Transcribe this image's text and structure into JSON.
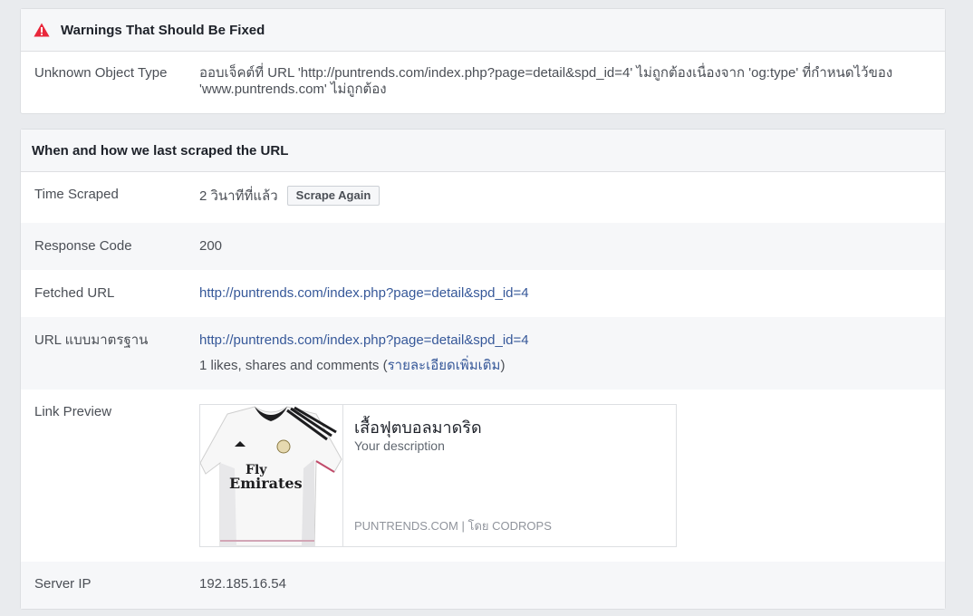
{
  "warnings": {
    "title": "Warnings That Should Be Fixed",
    "rows": [
      {
        "label": "Unknown Object Type",
        "value": "ออบเจ็คต์ที่ URL 'http://puntrends.com/index.php?page=detail&spd_id=4' ไม่ถูกต้องเนื่องจาก 'og:type' ที่กำหนดไว้ของ 'www.puntrends.com' ไม่ถูกต้อง"
      }
    ]
  },
  "scrape": {
    "title": "When and how we last scraped the URL",
    "time_scraped": {
      "label": "Time Scraped",
      "value": "2 วินาทีที่แล้ว",
      "button": "Scrape Again"
    },
    "response_code": {
      "label": "Response Code",
      "value": "200"
    },
    "fetched_url": {
      "label": "Fetched URL",
      "value": "http://puntrends.com/index.php?page=detail&spd_id=4"
    },
    "canonical_url": {
      "label": "URL แบบมาตรฐาน",
      "value": "http://puntrends.com/index.php?page=detail&spd_id=4",
      "stats": "1 likes, shares and comments (",
      "stats_link": "รายละเอียดเพิ่มเติม",
      "stats_close": ")"
    },
    "link_preview": {
      "label": "Link Preview",
      "title": "เสื้อฟุตบอลมาดริด",
      "description": "Your description",
      "domain": "PUNTRENDS.COM",
      "separator": "|",
      "by": "โดย CODROPS",
      "image_alt": "white football jersey",
      "jersey_text_line1": "Fly",
      "jersey_text_line2": "Emirates"
    },
    "server_ip": {
      "label": "Server IP",
      "value": "192.185.16.54"
    }
  },
  "colors": {
    "link": "#365899",
    "warning_icon": "#e9273b",
    "page_bg": "#e9ebee"
  }
}
